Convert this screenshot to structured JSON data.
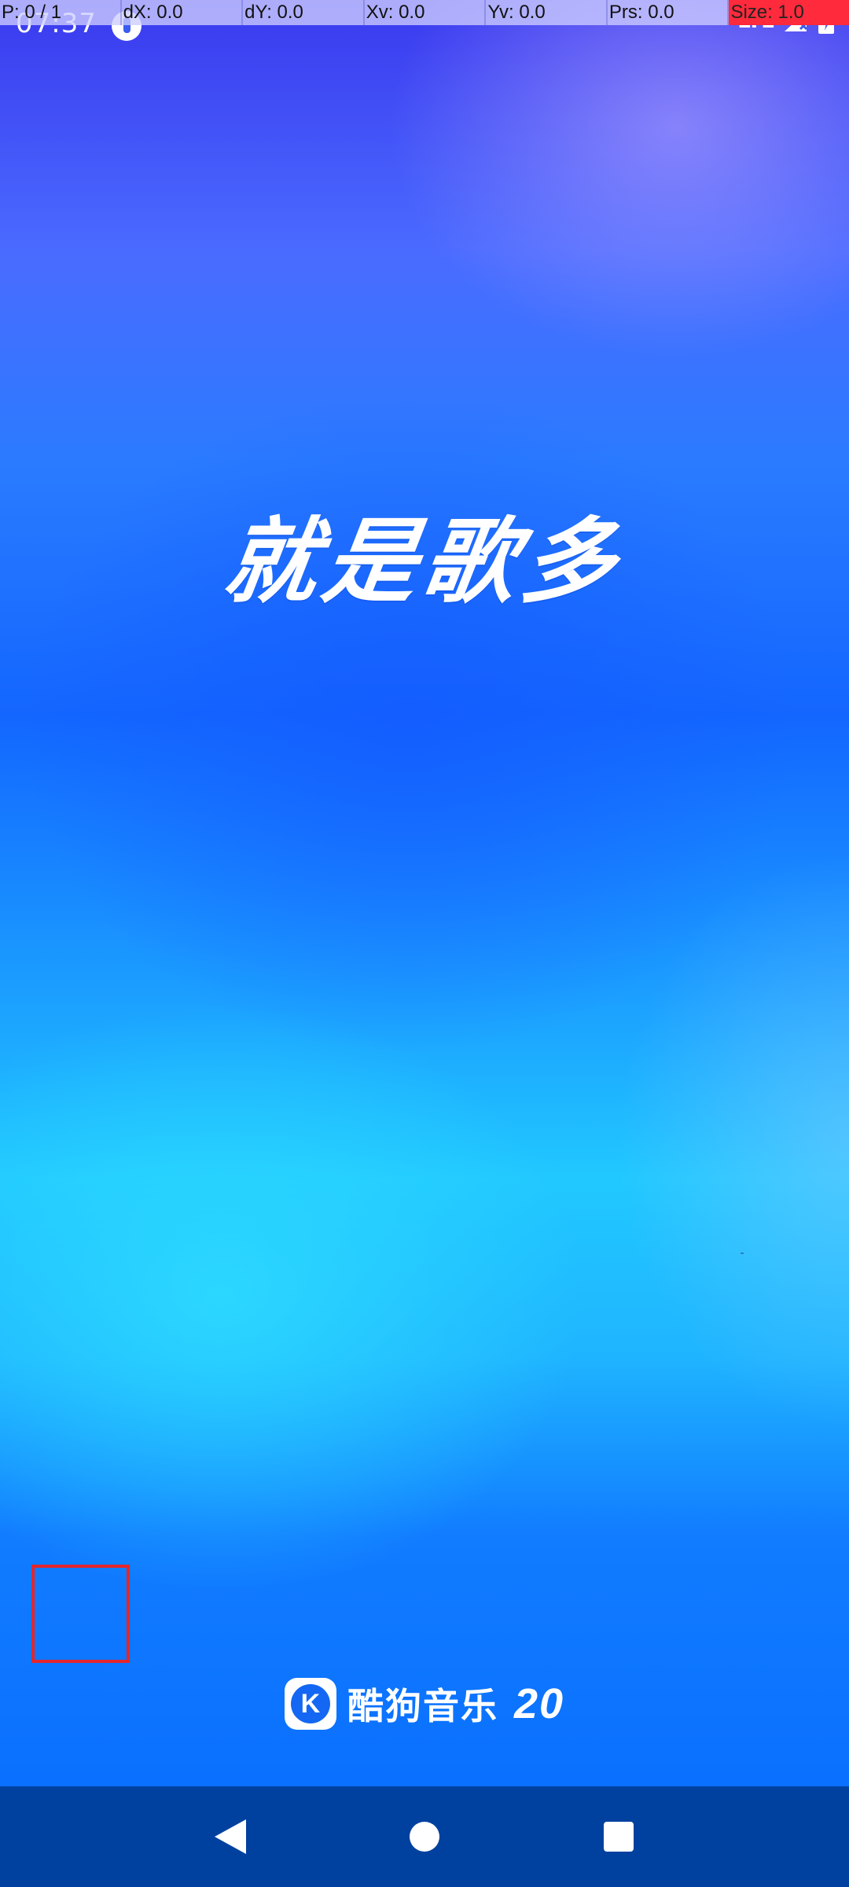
{
  "status_bar": {
    "time": "07:37",
    "network": "LTE",
    "icons": [
      "app-notification-icon",
      "signal-icon",
      "battery-icon"
    ]
  },
  "debug_overlay": {
    "pointer": "P: 0 / 1",
    "dx": "dX: 0.0",
    "dy": "dY: 0.0",
    "xv": "Xv: 0.0",
    "yv": "Yv: 0.0",
    "prs": "Prs: 0.0",
    "size": "Size: 1.0"
  },
  "splash": {
    "slogan": "就是歌多",
    "brand_name": "酷狗音乐",
    "brand_version": "20",
    "logo_letter": "K"
  },
  "nav_bar": {
    "buttons": [
      "back-icon",
      "home-icon",
      "recents-icon"
    ]
  },
  "colors": {
    "nav_background": "#00419f",
    "touch_highlight": "#e3262b",
    "debug_alert": "#ff2a3c"
  }
}
